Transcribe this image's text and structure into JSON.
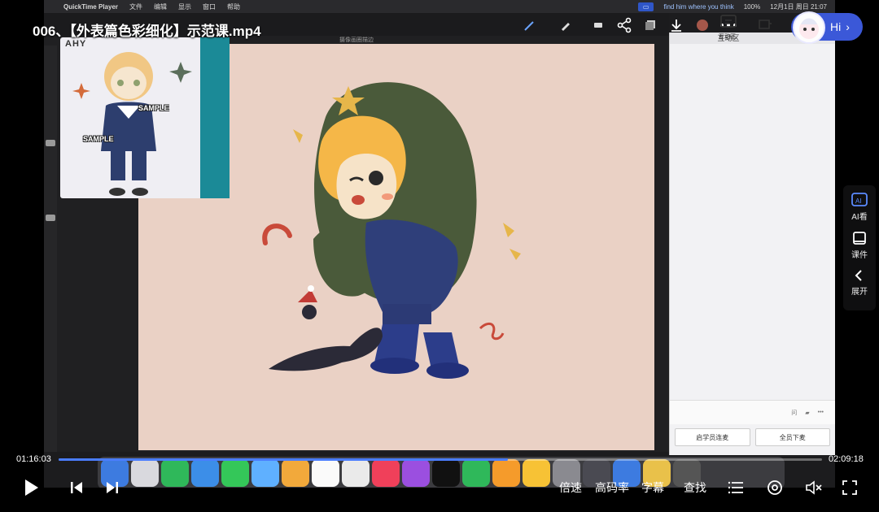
{
  "player": {
    "title": "006、【外表篇色彩细化】示范课.mp4",
    "current_time": "01:16:03",
    "total_time": "02:09:18",
    "progress": 0.588,
    "controls": {
      "speed": "倍速",
      "quality": "高码率",
      "subtitle": "字幕",
      "search": "查找"
    },
    "interact_label": "互动区",
    "hi_label": "Hi",
    "side_tools": [
      {
        "label": "AI看",
        "icon": "ai-watch-icon"
      },
      {
        "label": "课件",
        "icon": "courseware-icon"
      },
      {
        "label": "展开",
        "icon": "chevron-left-icon"
      }
    ],
    "accent_color": "#3b58d8"
  },
  "video": {
    "menubar": {
      "app_name": "QuickTime Player",
      "menus": [
        "文件",
        "编辑",
        "显示",
        "窗口",
        "帮助"
      ],
      "tooltip_chip": "▭",
      "tooltip_text": "find him where you think",
      "battery": "100%",
      "datetime": "12月1日 周日 21:07"
    },
    "app": {
      "subtitle": "摄像画圈描边",
      "ref_brand": "AHY",
      "sample_1": "SAMPLE",
      "sample_2": "SAMPLE"
    },
    "chat": {
      "top_label": "互动区",
      "input_hint": "问",
      "btn_1": "启学员连麦",
      "btn_2": "全员下麦"
    }
  }
}
